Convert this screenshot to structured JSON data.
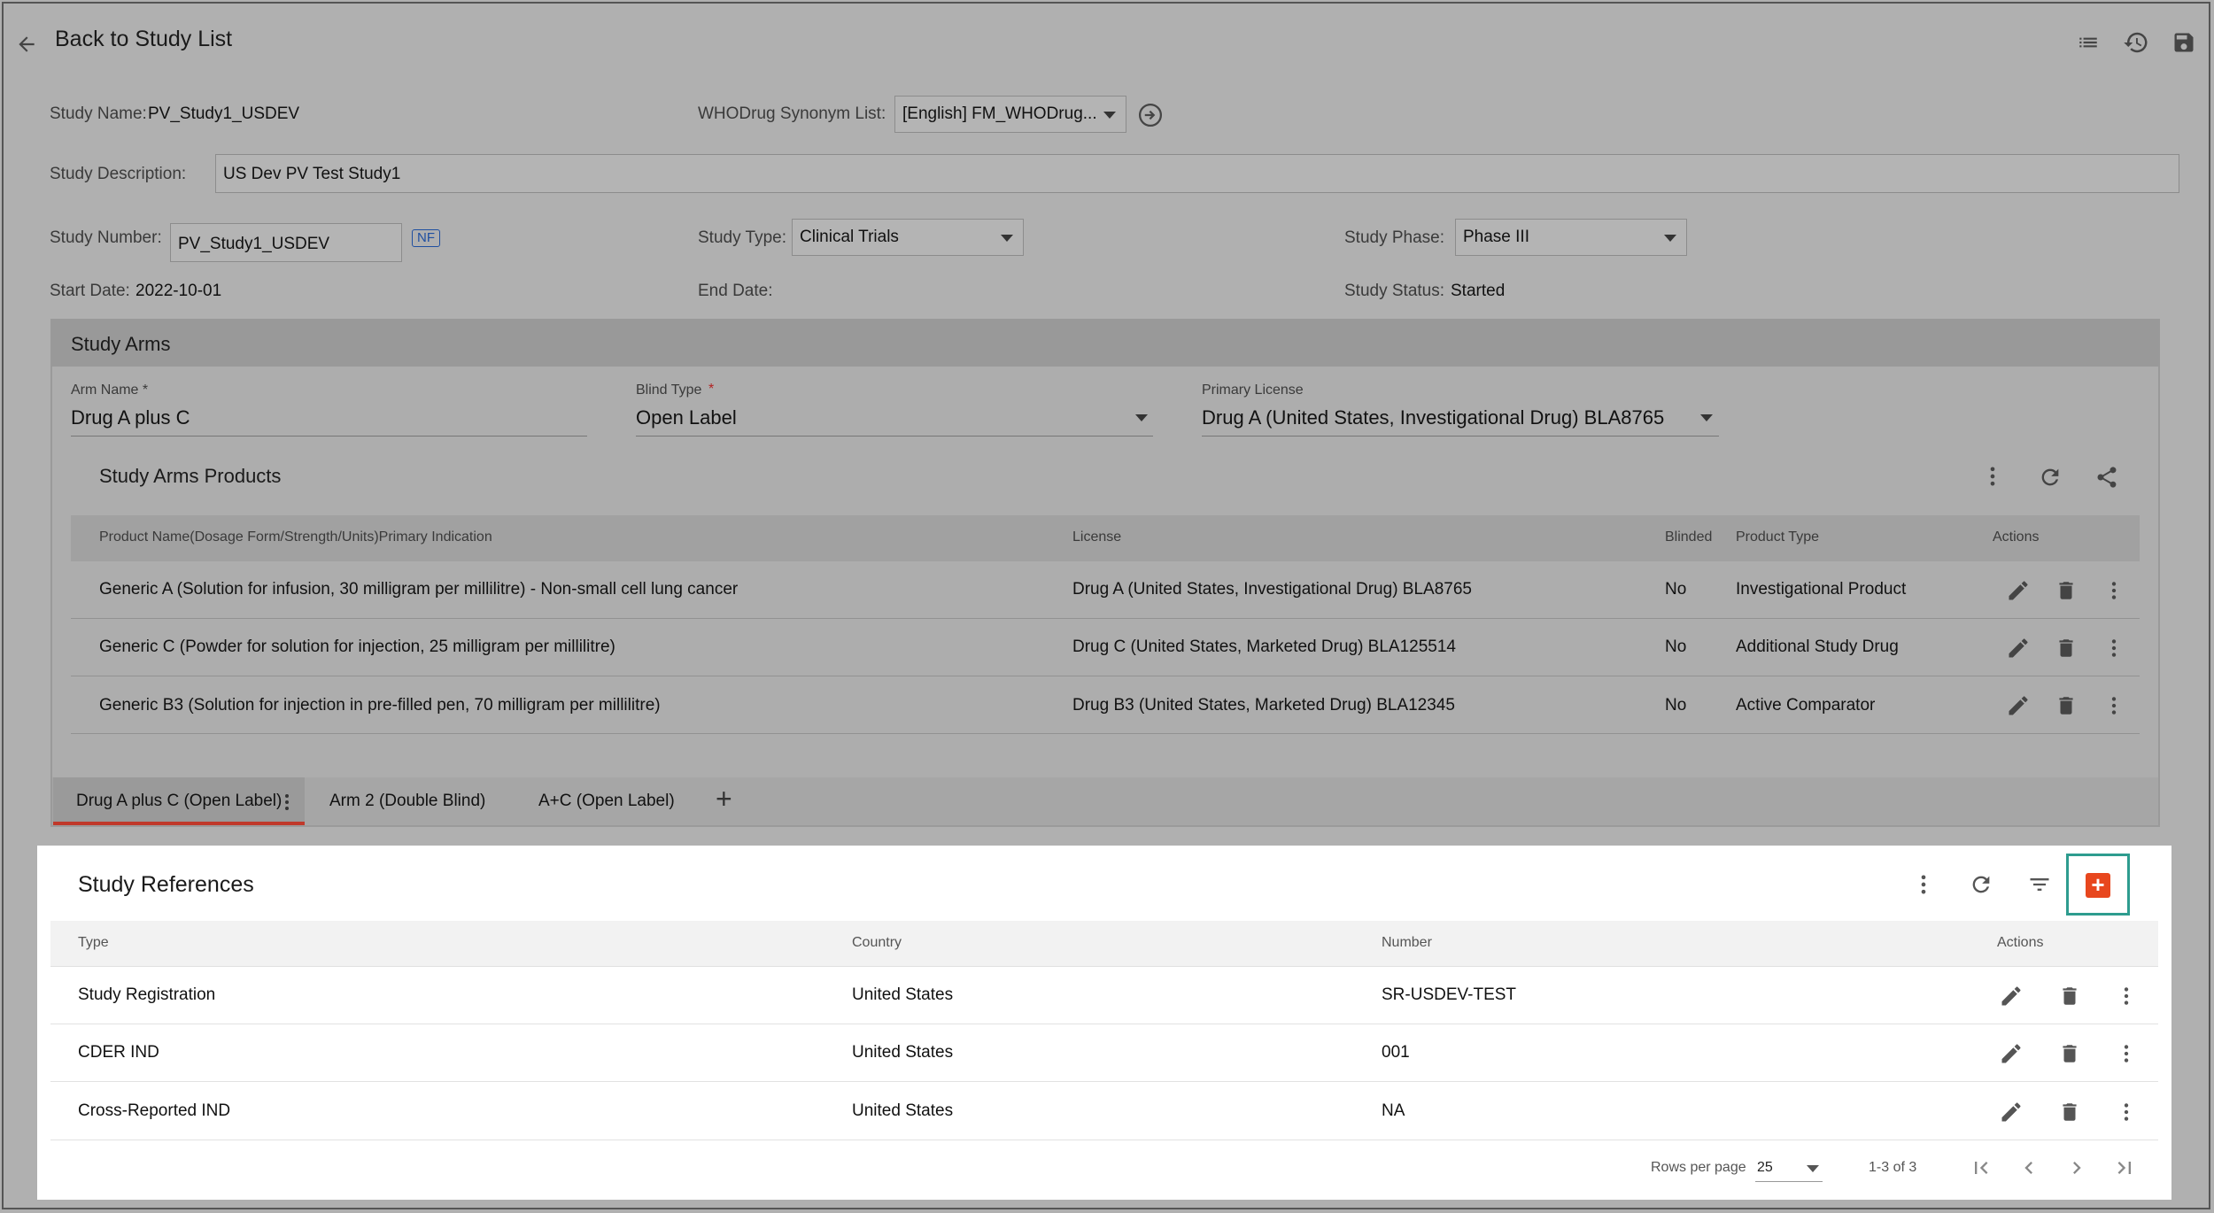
{
  "header": {
    "back_label": "Back to Study List",
    "icons": [
      "arrow-left-icon",
      "list-icon",
      "history-icon",
      "save-icon"
    ]
  },
  "study": {
    "name_label": "Study Name:",
    "name_value": "PV_Study1_USDEV",
    "synonym_label": "WHODrug Synonym List:",
    "synonym_value": "[English] FM_WHODrug...",
    "description_label": "Study Description:",
    "description_value": "US Dev PV Test Study1",
    "number_label": "Study Number:",
    "number_value": "PV_Study1_USDEV",
    "nf_badge": "NF",
    "type_label": "Study Type:",
    "type_value": "Clinical Trials",
    "phase_label": "Study Phase:",
    "phase_value": "Phase III",
    "start_label": "Start Date:",
    "start_value": "2022-10-01",
    "end_label": "End Date:",
    "status_label": "Study Status:",
    "status_value": "Started"
  },
  "arms": {
    "title": "Study Arms",
    "arm_name_label": "Arm Name *",
    "arm_name_value": "Drug A plus C",
    "blind_type_label": "Blind Type",
    "blind_type_required": "*",
    "blind_type_value": "Open Label",
    "primary_license_label": "Primary License",
    "primary_license_value": "Drug A (United States, Investigational Drug) BLA8765",
    "products": {
      "title": "Study Arms Products",
      "columns": [
        "Product Name(Dosage Form/Strength/Units)Primary Indication",
        "License",
        "Blinded",
        "Product Type",
        "Actions"
      ],
      "rows": [
        {
          "product": "Generic A (Solution for infusion, 30 milligram per millilitre) - Non-small cell lung cancer",
          "license": "Drug A (United States, Investigational Drug) BLA8765",
          "blinded": "No",
          "type": "Investigational Product"
        },
        {
          "product": "Generic C (Powder for solution for injection, 25 milligram per millilitre)",
          "license": "Drug C (United States, Marketed Drug) BLA125514",
          "blinded": "No",
          "type": "Additional Study Drug"
        },
        {
          "product": "Generic B3 (Solution for injection in pre-filled pen, 70 milligram per millilitre)",
          "license": "Drug B3 (United States, Marketed Drug) BLA12345",
          "blinded": "No",
          "type": "Active Comparator"
        }
      ]
    },
    "tabs": [
      "Drug A plus C (Open Label)",
      "Arm 2 (Double Blind)",
      "A+C (Open Label)"
    ],
    "add_tab": "+"
  },
  "references": {
    "title": "Study References",
    "columns": [
      "Type",
      "Country",
      "Number",
      "Actions"
    ],
    "rows": [
      {
        "type": "Study Registration",
        "country": "United States",
        "number": "SR-USDEV-TEST"
      },
      {
        "type": "CDER IND",
        "country": "United States",
        "number": "001"
      },
      {
        "type": "Cross-Reported IND",
        "country": "United States",
        "number": "NA"
      }
    ],
    "add_symbol": "+",
    "pagination": {
      "rows_per_page_label": "Rows per page",
      "rows_per_page_value": "25",
      "range": "1-3 of 3"
    }
  },
  "colors": {
    "accent_add": "#e8471e",
    "highlight_border": "#2e9c8f",
    "tab_indicator": "#c0392b"
  }
}
